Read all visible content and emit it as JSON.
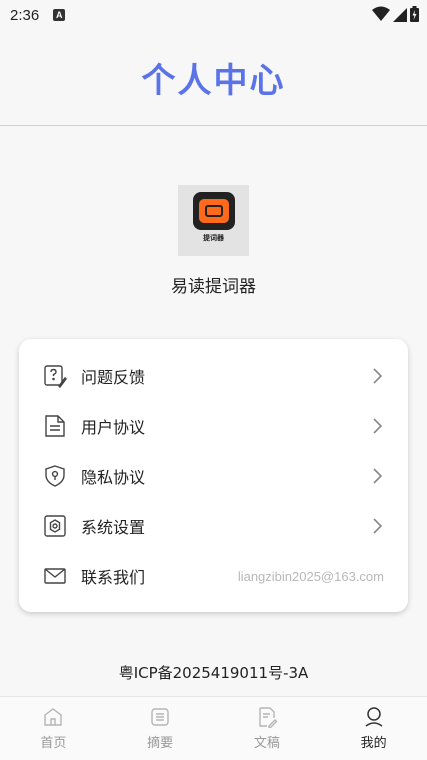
{
  "status_bar": {
    "time": "2:36",
    "notification_badge": "A"
  },
  "header": {
    "title": "个人中心"
  },
  "app": {
    "name": "易读提词器",
    "logo_text": "提词器"
  },
  "menu": {
    "items": [
      {
        "label": "问题反馈",
        "icon": "feedback-icon",
        "chevron": true
      },
      {
        "label": "用户协议",
        "icon": "document-icon",
        "chevron": true
      },
      {
        "label": "隐私协议",
        "icon": "shield-icon",
        "chevron": true
      },
      {
        "label": "系统设置",
        "icon": "settings-icon",
        "chevron": true
      },
      {
        "label": "联系我们",
        "icon": "mail-icon",
        "email": "liangzibin2025@163.com"
      }
    ]
  },
  "footer": {
    "icp": "粤ICP备2025419011号-3A"
  },
  "tabs": [
    {
      "label": "首页",
      "icon": "home-icon",
      "active": false
    },
    {
      "label": "摘要",
      "icon": "summary-icon",
      "active": false
    },
    {
      "label": "文稿",
      "icon": "edit-document-icon",
      "active": false
    },
    {
      "label": "我的",
      "icon": "user-icon",
      "active": true
    }
  ],
  "colors": {
    "accent": "#5b73e8",
    "background": "#f7f7f7",
    "logo_orange": "#ff6a1a"
  }
}
